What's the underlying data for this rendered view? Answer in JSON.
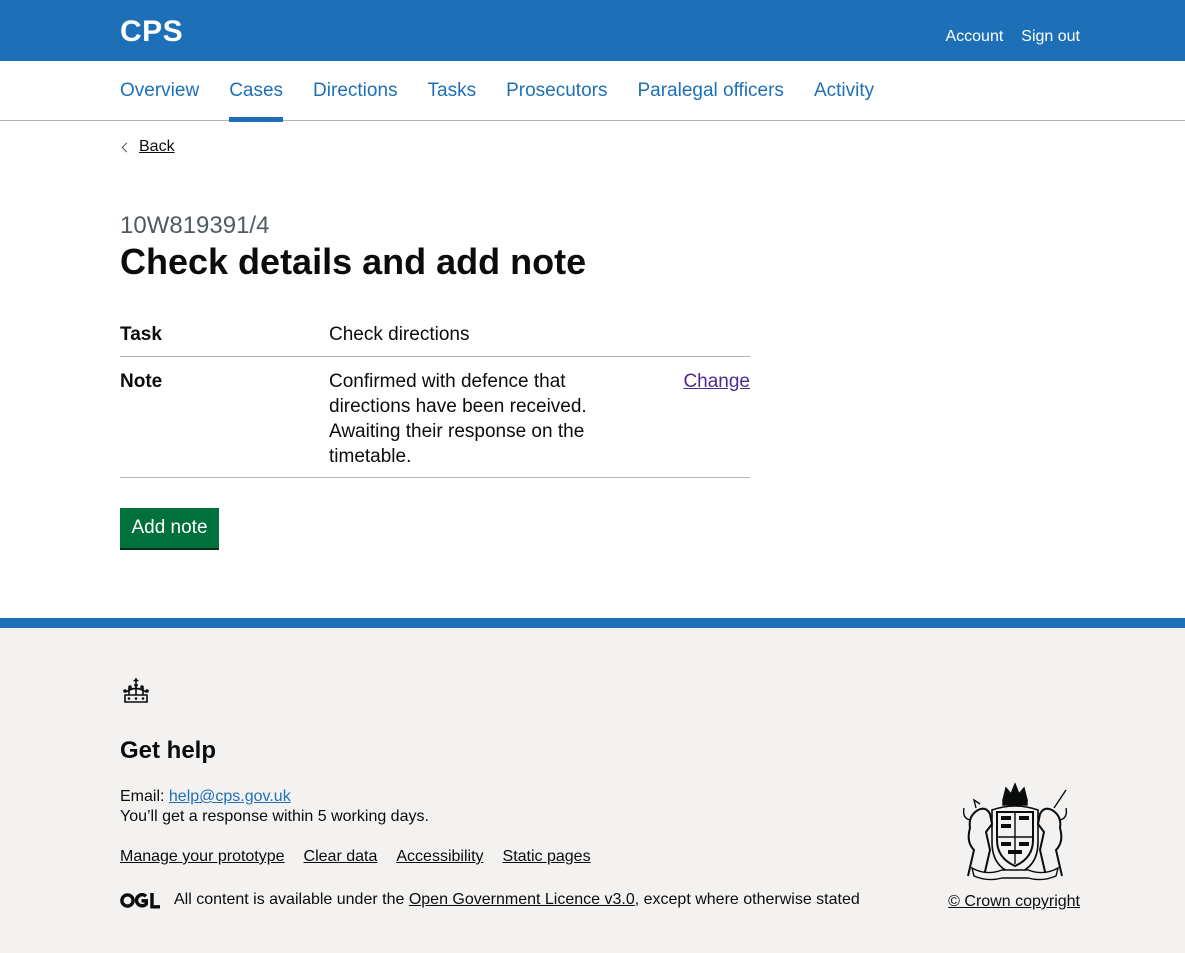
{
  "header": {
    "brand": "CPS",
    "links": {
      "account": "Account",
      "sign_out": "Sign out"
    }
  },
  "nav": {
    "items": [
      {
        "label": "Overview"
      },
      {
        "label": "Cases",
        "active": true
      },
      {
        "label": "Directions"
      },
      {
        "label": "Tasks"
      },
      {
        "label": "Prosecutors"
      },
      {
        "label": "Paralegal officers"
      },
      {
        "label": "Activity"
      }
    ]
  },
  "back": {
    "label": "Back"
  },
  "page": {
    "caption": "10W819391/4",
    "title": "Check details and add note"
  },
  "summary": {
    "rows": [
      {
        "key": "Task",
        "value": "Check directions",
        "action": ""
      },
      {
        "key": "Note",
        "value": "Confirmed with defence that directions have been received. Awaiting their response on the timetable.",
        "action": "Change"
      }
    ]
  },
  "actions": {
    "add_note": "Add note"
  },
  "footer": {
    "help_title": "Get help",
    "email_label": "Email:",
    "email": "help@cps.gov.uk",
    "response": "You’ll get a response within 5 working days.",
    "links": {
      "manage": "Manage your prototype",
      "clear": "Clear data",
      "accessibility": "Accessibility",
      "static": "Static pages"
    },
    "licence_prefix": "All content is available under the",
    "licence_link": "Open Government Licence v3.0",
    "licence_suffix": ", except where otherwise stated",
    "crown_copyright": "© Crown copyright"
  },
  "icons": {
    "back": "chevron-left-icon",
    "crown": "crown-icon",
    "ogl": "ogl-logo",
    "coat_of_arms": "royal-coat-of-arms"
  },
  "colors": {
    "brand_blue": "#1d70b8",
    "button_green": "#00703c",
    "visited_link": "#4c2c92",
    "footer_bg": "#f3f2f1"
  }
}
